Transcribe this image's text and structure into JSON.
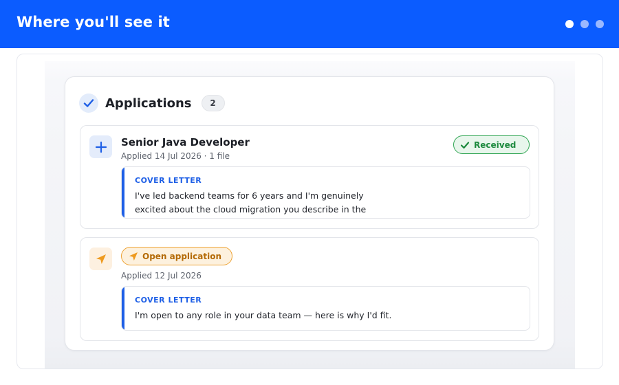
{
  "header": {
    "title": "Where you'll see it",
    "pagination_dots": 3,
    "active_dot": 1
  },
  "applications": {
    "title": "Applications",
    "count": "2",
    "items": [
      {
        "job_title": "Senior Java Developer",
        "meta": "Applied 14 Jul 2026 · 1 file",
        "status": "Received",
        "status_icon": "check-icon",
        "icon": "plus-icon",
        "cover_letter_label": "COVER LETTER",
        "cover_letter_text": "I've led backend teams for 6 years and I'm genuinely excited about the cloud migration you describe in the posting."
      },
      {
        "job_title": "",
        "meta": "Applied 12 Jul 2026",
        "status": "Open application",
        "status_icon": "send-icon",
        "icon": "send-icon",
        "cover_letter_label": "COVER LETTER",
        "cover_letter_text": "I'm open to any role in your data team — here is why I'd fit."
      }
    ]
  },
  "colors": {
    "header_bg": "#0b5cff",
    "accent_blue": "#1e5fe6",
    "received_green": "#2fa552",
    "open_orange": "#eda233"
  }
}
